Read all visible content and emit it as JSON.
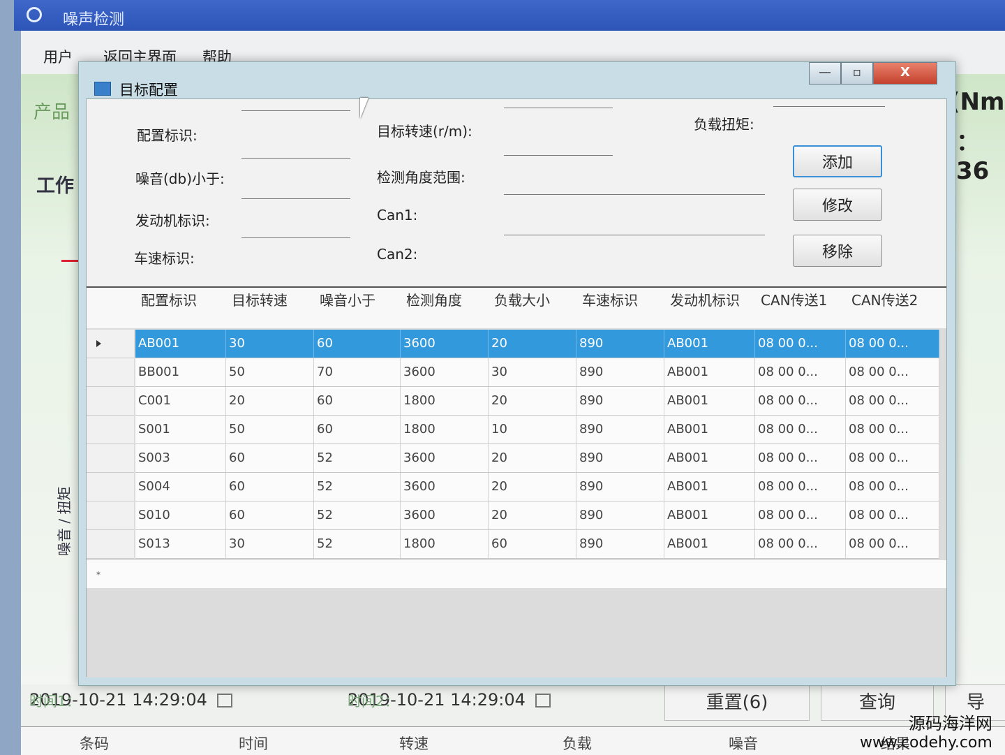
{
  "app": {
    "title": "噪声检测",
    "menu": [
      "用户",
      "返回主界面",
      "帮助"
    ],
    "product_label": "产品",
    "work_label": "工作",
    "right_big1": "(Nm",
    "right_big2": "：36",
    "y_axis_label": "噪音 / 扭矩",
    "time1_label": "时间1：",
    "time1_value": "2019-10-21 14:29:04",
    "time2_label": "时间2：",
    "time2_value": "2019-10-21 14:29:04",
    "reset_button": "重置(6)",
    "query_button": "查询",
    "export_button": "导",
    "grid_headers": [
      "条码",
      "时间",
      "转速",
      "负载",
      "噪音",
      "结果"
    ]
  },
  "dialog": {
    "title": "目标配置",
    "window_buttons": {
      "minimize": "—",
      "restore": "▫",
      "close": "X"
    },
    "form": {
      "config_id_label": "配置标识:",
      "noise_label": "噪音(db)小于:",
      "engine_id_label": "发动机标识:",
      "speed_id_label": "车速标识:",
      "target_speed_label": "目标转速(r/m):",
      "angle_range_label": "检测角度范围:",
      "can1_label": "Can1:",
      "can2_label": "Can2:",
      "load_torque_label": "负载扭矩:"
    },
    "buttons": {
      "add": "添加",
      "modify": "修改",
      "remove": "移除"
    },
    "table": {
      "headers": [
        "配置标识",
        "目标转速",
        "噪音小于",
        "检测角度",
        "负载大小",
        "车速标识",
        "发动机标识",
        "CAN传送1",
        "CAN传送2"
      ],
      "rows": [
        [
          "AB001",
          "30",
          "60",
          "3600",
          "20",
          "890",
          "AB001",
          "08 00 0...",
          "08 00 0..."
        ],
        [
          "BB001",
          "50",
          "70",
          "3600",
          "30",
          "890",
          "AB001",
          "08 00 0...",
          "08 00 0..."
        ],
        [
          "C001",
          "20",
          "60",
          "1800",
          "20",
          "890",
          "AB001",
          "08 00 0...",
          "08 00 0..."
        ],
        [
          "S001",
          "50",
          "60",
          "1800",
          "10",
          "890",
          "AB001",
          "08 00 0...",
          "08 00 0..."
        ],
        [
          "S003",
          "60",
          "52",
          "3600",
          "20",
          "890",
          "AB001",
          "08 00 0...",
          "08 00 0..."
        ],
        [
          "S004",
          "60",
          "52",
          "3600",
          "20",
          "890",
          "AB001",
          "08 00 0...",
          "08 00 0..."
        ],
        [
          "S010",
          "60",
          "52",
          "3600",
          "20",
          "890",
          "AB001",
          "08 00 0...",
          "08 00 0..."
        ],
        [
          "S013",
          "30",
          "52",
          "1800",
          "60",
          "890",
          "AB001",
          "08 00 0...",
          "08 00 0..."
        ]
      ],
      "selected_row": 0,
      "new_row_marker": "*"
    }
  },
  "watermark": {
    "line1": "源码海洋网",
    "line2": "www.codehy.com"
  },
  "colors": {
    "selection": "#3399dd",
    "titlebar": "#3f67c9",
    "close": "#c4412d"
  }
}
